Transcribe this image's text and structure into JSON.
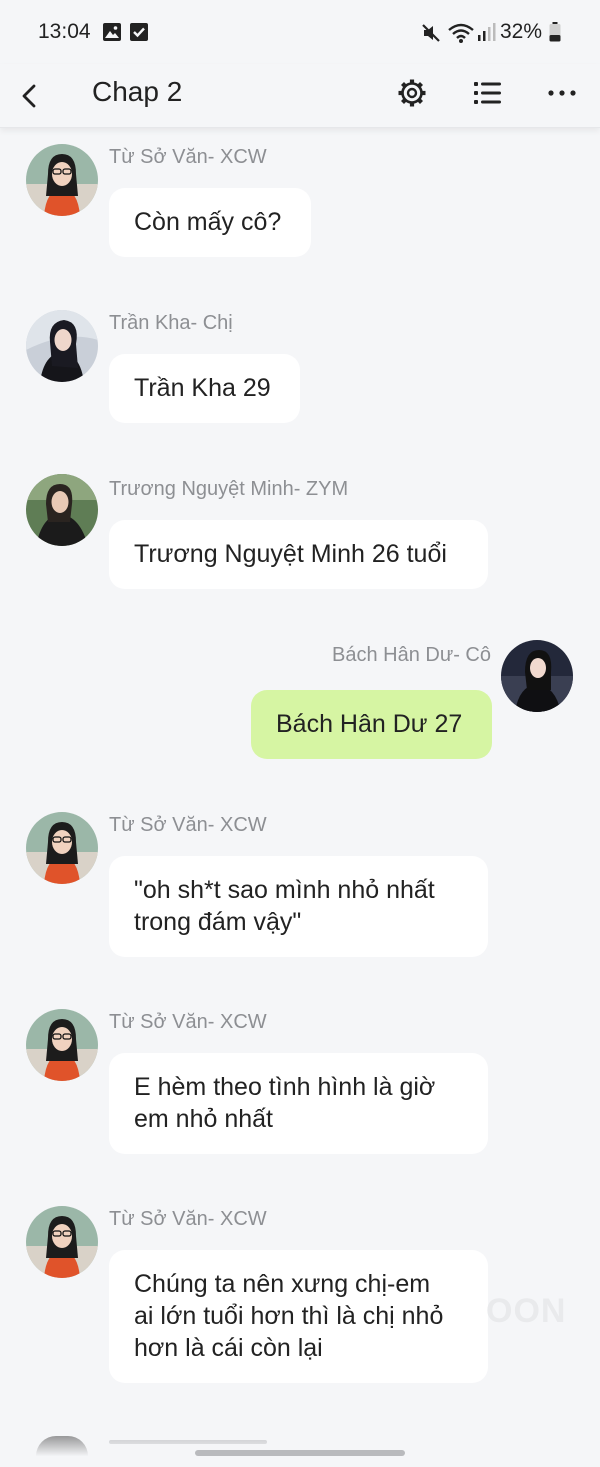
{
  "status_bar": {
    "time": "13:04",
    "battery": "32%",
    "icons": [
      "image-icon",
      "checkbox-icon",
      "mute-icon",
      "wifi-icon",
      "signal-icon",
      "battery-icon"
    ]
  },
  "app_bar": {
    "title": "Chap 2",
    "icons": [
      "back-icon",
      "settings-icon",
      "list-icon",
      "more-icon"
    ]
  },
  "messages": [
    {
      "sender": "Từ Sở Văn- XCW",
      "text": "Còn mấy cô?",
      "self": false
    },
    {
      "sender": "Trần Kha- Chị",
      "text": "Trần Kha 29",
      "self": false
    },
    {
      "sender": "Trương Nguyệt Minh- ZYM",
      "text": "Trương Nguyệt Minh 26 tuổi",
      "self": false
    },
    {
      "sender": "Bách Hân Dư- Cô",
      "text": "Bách Hân Dư 27",
      "self": true
    },
    {
      "sender": "Từ Sở Văn- XCW",
      "text": "\"oh sh*t sao mình nhỏ nhất\ntrong đám vậy\"",
      "self": false
    },
    {
      "sender": "Từ Sở Văn- XCW",
      "text": "E hèm theo tình hình là giờ\nem nhỏ nhất",
      "self": false
    },
    {
      "sender": "Từ Sở Văn- XCW",
      "text": "Chúng ta nên xưng chị-em\nai lớn tuổi hơn thì là chị nhỏ\nhơn là cái còn lại",
      "self": false
    }
  ],
  "watermark": "OON",
  "colors": {
    "background": "#f5f6f8",
    "bubble_other": "#ffffff",
    "bubble_self": "#d6f5a3",
    "sender_text": "#8d8f93"
  }
}
